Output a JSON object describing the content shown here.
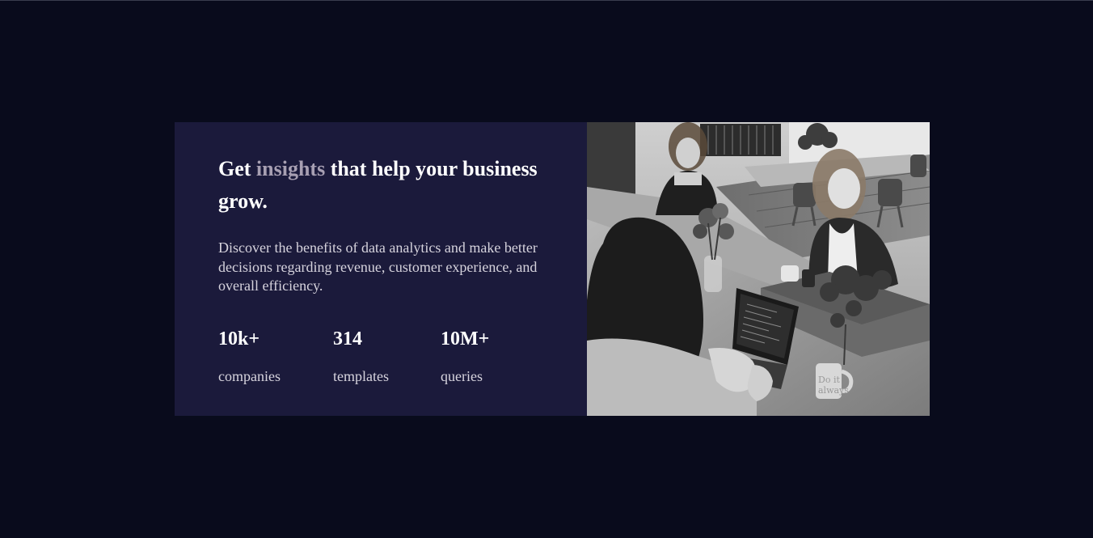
{
  "hero": {
    "headline_pre": "Get ",
    "headline_accent": "insights",
    "headline_post": " that help your business grow.",
    "description": "Discover the benefits of data analytics and make better decisions regarding revenue, customer experience, and overall efficiency.",
    "accent_color": "#a79fb2",
    "panel_color": "#1b1a3b",
    "page_background": "#090b1c"
  },
  "stats": [
    {
      "value": "10k+",
      "label": "companies"
    },
    {
      "value": "314",
      "label": "templates"
    },
    {
      "value": "10M+",
      "label": "queries"
    }
  ],
  "image": {
    "alt": "Women working together at an office table with a laptop",
    "mug_text": "Do it always"
  }
}
